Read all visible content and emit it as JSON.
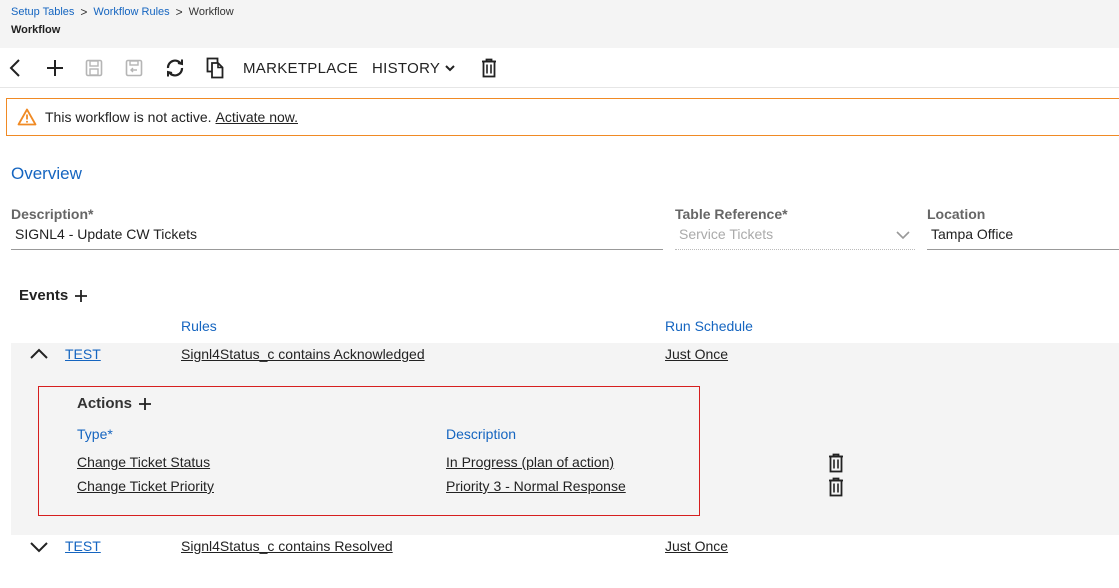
{
  "breadcrumb": {
    "items": [
      "Setup Tables",
      "Workflow Rules",
      "Workflow"
    ],
    "title": "Workflow"
  },
  "toolbar": {
    "marketplace_label": "MARKETPLACE",
    "history_label": "HISTORY"
  },
  "banner": {
    "message": "This workflow is not active.",
    "link": "Activate now."
  },
  "overview": {
    "title": "Overview",
    "description_label": "Description*",
    "description_value": "SIGNL4 - Update CW Tickets",
    "table_reference_label": "Table Reference*",
    "table_reference_value": "Service Tickets",
    "location_label": "Location",
    "location_value": "Tampa Office"
  },
  "events": {
    "title": "Events",
    "headers": {
      "rules": "Rules",
      "run_schedule": "Run Schedule"
    },
    "rows": [
      {
        "name": "TEST",
        "rule": "Signl4Status_c contains Acknowledged",
        "schedule": "Just Once",
        "expanded": true
      },
      {
        "name": "TEST",
        "rule": "Signl4Status_c contains Resolved",
        "schedule": "Just Once",
        "expanded": false
      }
    ]
  },
  "actions": {
    "title": "Actions",
    "headers": {
      "type": "Type*",
      "description": "Description"
    },
    "rows": [
      {
        "type": "Change Ticket Status",
        "description": "In Progress (plan of action)"
      },
      {
        "type": "Change Ticket Priority",
        "description": "Priority 3 - Normal Response"
      }
    ]
  },
  "colors": {
    "accent": "#1565c0",
    "warning": "#f08a24",
    "highlight": "#d61f1f"
  }
}
